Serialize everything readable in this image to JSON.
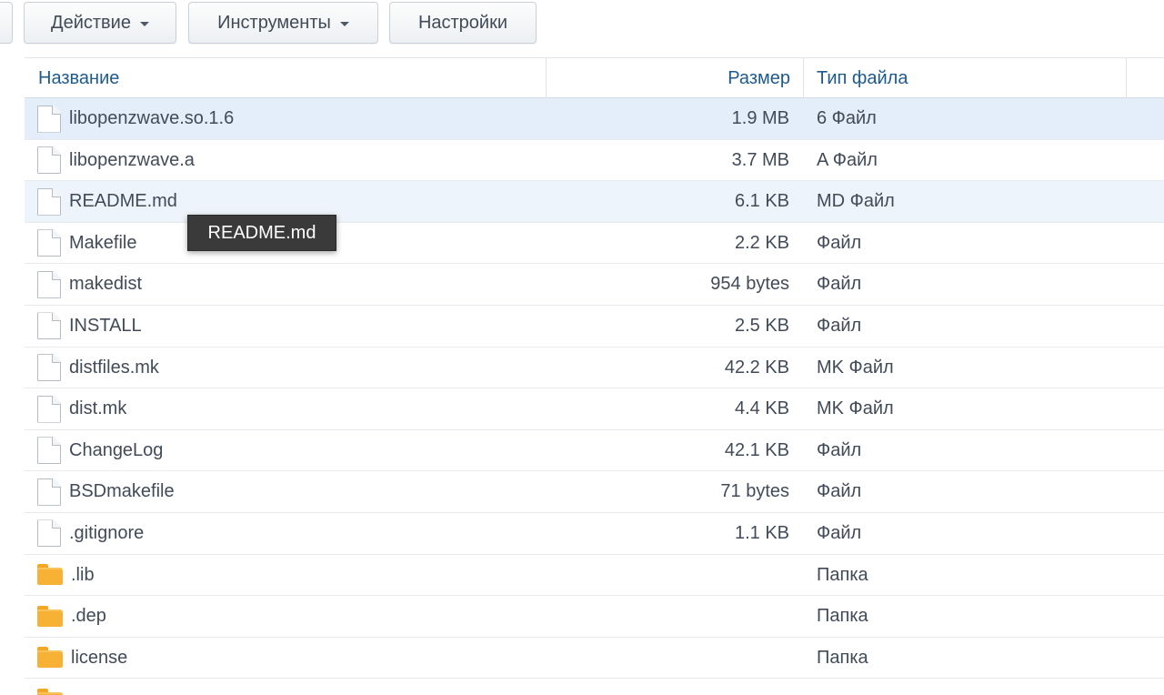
{
  "toolbar": {
    "action_label": "Действие",
    "tools_label": "Инструменты",
    "settings_label": "Настройки"
  },
  "columns": {
    "name": "Название",
    "size": "Размер",
    "type": "Тип файла"
  },
  "rows": [
    {
      "name": "libopenzwave.so.1.6",
      "size": "1.9 MB",
      "type": "6 Файл",
      "icon": "file-icon"
    },
    {
      "name": "libopenzwave.a",
      "size": "3.7 MB",
      "type": "A Файл",
      "icon": "file-icon"
    },
    {
      "name": "README.md",
      "size": "6.1 KB",
      "type": "MD Файл",
      "icon": "file-icon"
    },
    {
      "name": "Makefile",
      "size": "2.2 KB",
      "type": "Файл",
      "icon": "file-icon"
    },
    {
      "name": "makedist",
      "size": "954 bytes",
      "type": "Файл",
      "icon": "file-icon"
    },
    {
      "name": "INSTALL",
      "size": "2.5 KB",
      "type": "Файл",
      "icon": "file-icon"
    },
    {
      "name": "distfiles.mk",
      "size": "42.2 KB",
      "type": "MK Файл",
      "icon": "file-icon"
    },
    {
      "name": "dist.mk",
      "size": "4.4 KB",
      "type": "MK Файл",
      "icon": "file-icon"
    },
    {
      "name": "ChangeLog",
      "size": "42.1 KB",
      "type": "Файл",
      "icon": "file-icon"
    },
    {
      "name": "BSDmakefile",
      "size": "71 bytes",
      "type": "Файл",
      "icon": "file-icon"
    },
    {
      "name": ".gitignore",
      "size": "1.1 KB",
      "type": "Файл",
      "icon": "file-icon"
    },
    {
      "name": ".lib",
      "size": "",
      "type": "Папка",
      "icon": "folder-icon"
    },
    {
      "name": ".dep",
      "size": "",
      "type": "Папка",
      "icon": "folder-icon"
    },
    {
      "name": "license",
      "size": "",
      "type": "Папка",
      "icon": "folder-icon"
    },
    {
      "name": "",
      "size": "",
      "type": "",
      "icon": "folder-icon"
    }
  ],
  "tooltip": {
    "text": "README.md"
  },
  "colors": {
    "header_text": "#1e5a8c",
    "selected_row": "#e3eefa",
    "hover_row": "#eef4fb",
    "folder": "#f7b134",
    "tooltip_bg": "#3a3a3a"
  }
}
